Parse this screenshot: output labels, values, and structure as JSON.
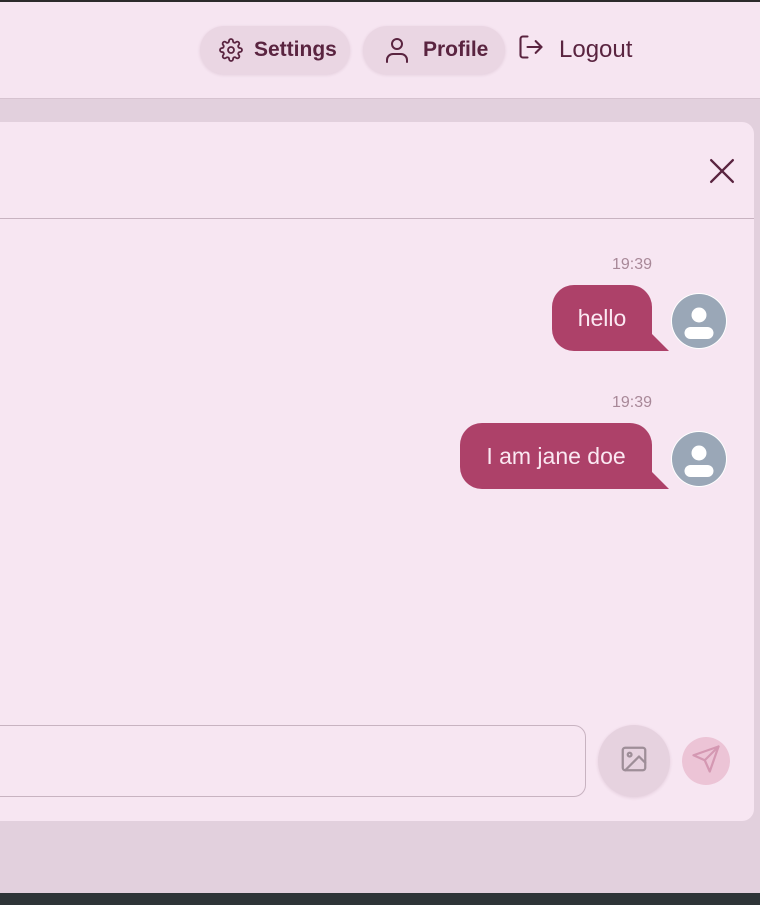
{
  "navbar": {
    "settings_label": "Settings",
    "profile_label": "Profile",
    "logout_label": "Logout",
    "icons": {
      "settings": "gear-icon",
      "profile": "user-icon",
      "logout": "logout-icon"
    }
  },
  "chat": {
    "close_icon": "close-icon",
    "messages": [
      {
        "time": "19:39",
        "text": "hello",
        "avatar": "default-avatar"
      },
      {
        "time": "19:39",
        "text": "I am jane doe",
        "avatar": "default-avatar"
      }
    ],
    "composer": {
      "placeholder": "",
      "image_icon": "image-icon",
      "send_icon": "send-icon"
    }
  },
  "colors": {
    "accent": "#ad4169",
    "nav_text": "#5a2440",
    "surface": "#f7e6f2",
    "background": "#e2d0dd"
  }
}
